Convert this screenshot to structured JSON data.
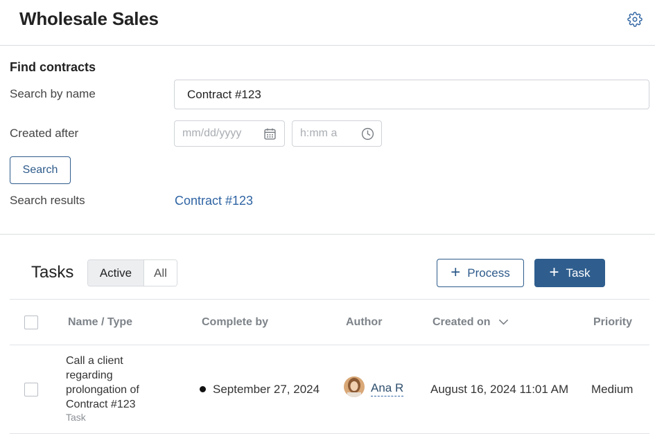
{
  "header": {
    "title": "Wholesale Sales",
    "settings_icon": "gear-icon"
  },
  "find_contracts": {
    "title": "Find contracts",
    "search_by_name_label": "Search by name",
    "search_value": "Contract #123",
    "created_after_label": "Created after",
    "date_placeholder": "mm/dd/yyyy",
    "time_placeholder": "h:mm a",
    "search_button": "Search",
    "results_label": "Search results",
    "result_link": "Contract #123"
  },
  "tasks": {
    "title": "Tasks",
    "filter_active": "Active",
    "filter_all": "All",
    "process_button": "Process",
    "task_button": "Task",
    "columns": {
      "name_type": "Name / Type",
      "complete_by": "Complete by",
      "author": "Author",
      "created_on": "Created on",
      "priority": "Priority"
    },
    "rows": [
      {
        "name": "Call a client regarding prolongation of Contract #123",
        "type": "Task",
        "complete_by": "September 27, 2024",
        "author": "Ana R",
        "created_on": "August 16, 2024 11:01 AM",
        "priority": "Medium"
      }
    ]
  },
  "colors": {
    "accent": "#2f5e8e",
    "link": "#2f64a3",
    "border": "#cfd3d8"
  }
}
